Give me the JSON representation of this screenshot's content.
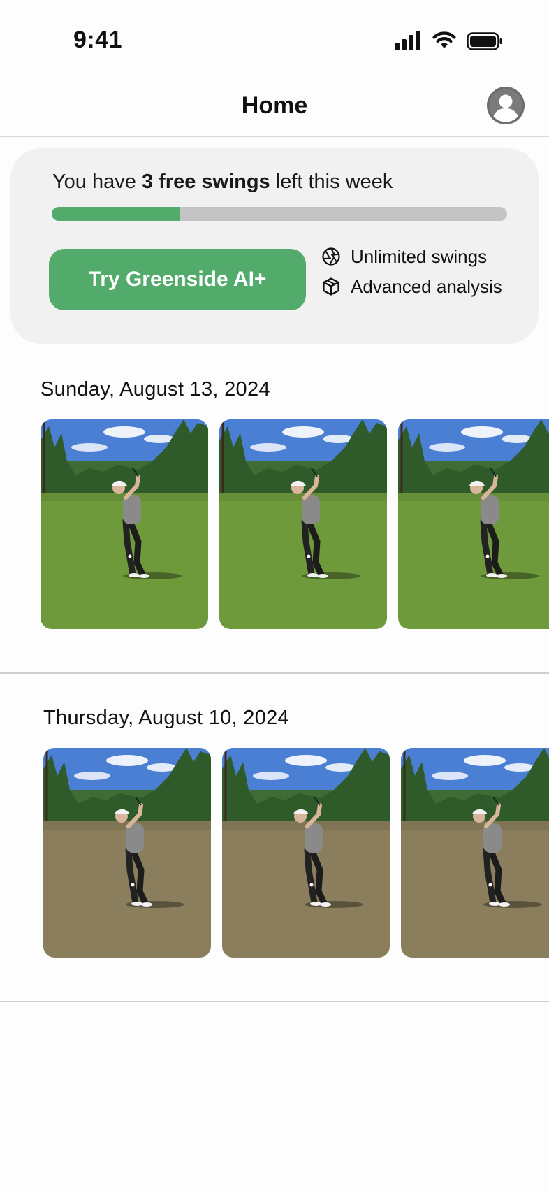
{
  "status_bar": {
    "time": "9:41"
  },
  "header": {
    "title": "Home"
  },
  "promo": {
    "prefix": "You have ",
    "highlight": "3 free swings",
    "suffix": " left this week",
    "progress": 0.28,
    "button_label": "Try Greenside AI+",
    "features": [
      {
        "icon": "aperture-icon",
        "label": "Unlimited swings"
      },
      {
        "icon": "cube-icon",
        "label": "Advanced analysis"
      }
    ]
  },
  "sessions": [
    {
      "date": "Sunday, August 13, 2024",
      "thumbnails": 3,
      "grass": "#6f9a3c"
    },
    {
      "date": "Thursday, August 10, 2024",
      "thumbnails": 3,
      "grass": "#8a7e5c"
    }
  ],
  "colors": {
    "accent": "#52ab6b",
    "track": "#c4c4c4",
    "card": "#f1f1f1"
  }
}
